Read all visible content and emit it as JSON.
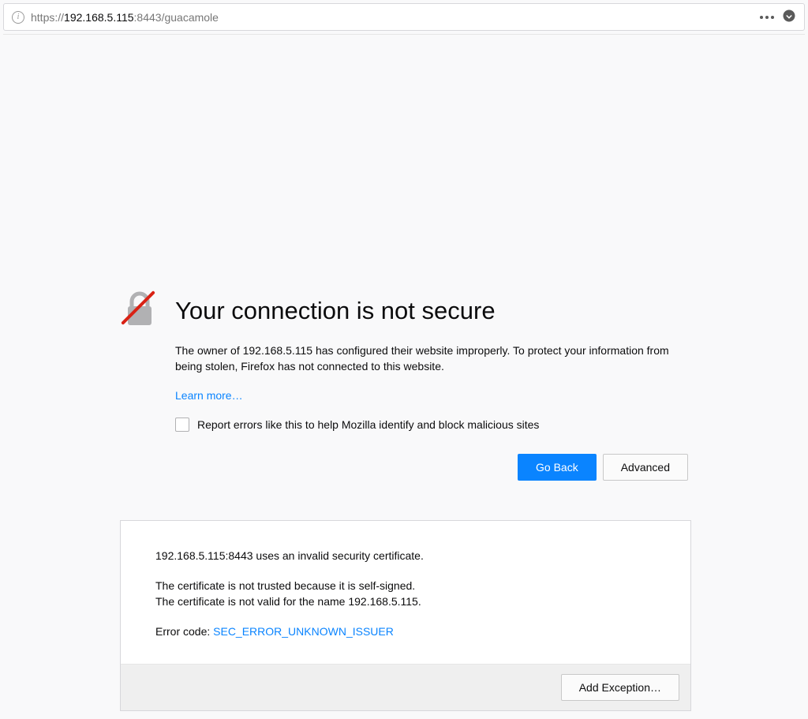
{
  "urlbar": {
    "protocol": "https://",
    "host": "192.168.5.115",
    "rest": ":8443/guacamole"
  },
  "error": {
    "title": "Your connection is not secure",
    "description": "The owner of 192.168.5.115 has configured their website improperly. To protect your information from being stolen, Firefox has not connected to this website.",
    "learn_more": "Learn more…",
    "report_label": "Report errors like this to help Mozilla identify and block malicious sites",
    "go_back": "Go Back",
    "advanced": "Advanced"
  },
  "advanced_panel": {
    "line1": "192.168.5.115:8443 uses an invalid security certificate.",
    "line2": "The certificate is not trusted because it is self-signed.",
    "line3": "The certificate is not valid for the name 192.168.5.115.",
    "error_code_label": "Error code: ",
    "error_code": "SEC_ERROR_UNKNOWN_ISSUER",
    "add_exception": "Add Exception…"
  }
}
